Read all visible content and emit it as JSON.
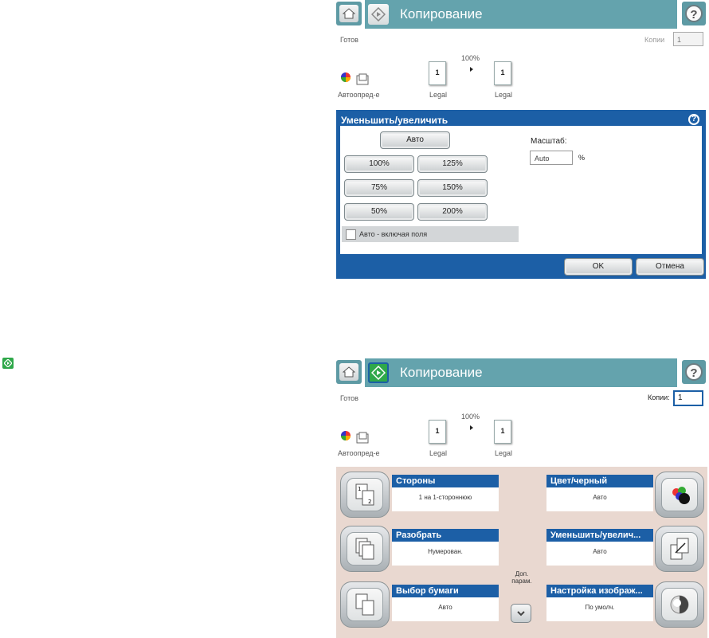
{
  "screen1": {
    "title": "Копирование",
    "status": "Готов",
    "copies_label": "Копии",
    "copies_value": "1",
    "scale_percent": "100%",
    "source_label": "Автоопред-е",
    "paper_in": "Legal",
    "paper_out": "Legal",
    "paper_count_in": "1",
    "paper_count_out": "1",
    "dialog": {
      "title": "Уменьшить/увеличить",
      "auto_button": "Авто",
      "options": [
        "100%",
        "125%",
        "75%",
        "150%",
        "50%",
        "200%"
      ],
      "scale_label": "Масштаб:",
      "scale_value": "Auto",
      "percent_sign": "%",
      "checkbox_label": "Авто - включая поля",
      "ok_label": "OK",
      "cancel_label": "Отмена"
    }
  },
  "screen2": {
    "title": "Копирование",
    "status": "Готов",
    "copies_label": "Копии:",
    "copies_value": "1",
    "scale_percent": "100%",
    "source_label": "Автоопред-е",
    "paper_in": "Legal",
    "paper_out": "Legal",
    "paper_count_in": "1",
    "paper_count_out": "1",
    "more_options": "Доп. парам.",
    "tiles": {
      "sides": {
        "title": "Стороны",
        "value": "1 на 1-стороннюю"
      },
      "color": {
        "title": "Цвет/черный",
        "value": "Авто"
      },
      "collate": {
        "title": "Разобрать",
        "value": "Нумерован."
      },
      "reduce": {
        "title": "Уменьшить/увелич...",
        "value": "Авто"
      },
      "paper": {
        "title": "Выбор бумаги",
        "value": "Авто"
      },
      "image": {
        "title": "Настройка изображ...",
        "value": "По умолч."
      }
    }
  },
  "colors": {
    "title_bar": "#64a3ad",
    "dialog_blue": "#1c5fa6",
    "start_green": "#2fa84a",
    "home_bg": "#e9d8d0"
  },
  "icons": [
    "home-icon",
    "start-copy-icon",
    "help-icon",
    "color-source-icon",
    "arrow-right-icon",
    "chevron-down-icon"
  ]
}
